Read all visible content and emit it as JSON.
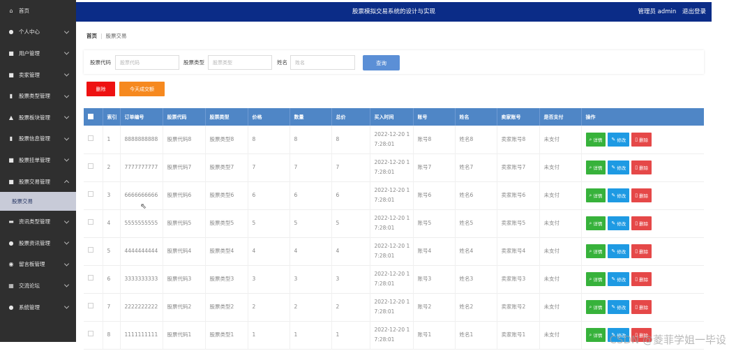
{
  "header": {
    "title": "股票模拟交易系统的设计与实现",
    "user_label": "管理员 admin",
    "logout_label": "退出登录"
  },
  "sidebar": {
    "items": [
      {
        "label": "首页",
        "icon": "home-icon",
        "expandable": false
      },
      {
        "label": "个人中心",
        "icon": "user-icon",
        "expandable": true
      },
      {
        "label": "用户管理",
        "icon": "grid-icon",
        "expandable": true
      },
      {
        "label": "卖家管理",
        "icon": "grid-icon",
        "expandable": true
      },
      {
        "label": "股票类型管理",
        "icon": "clipboard-icon",
        "expandable": true
      },
      {
        "label": "股票板块管理",
        "icon": "bank-icon",
        "expandable": true
      },
      {
        "label": "股票信息管理",
        "icon": "clipboard-icon",
        "expandable": true
      },
      {
        "label": "股票挂单管理",
        "icon": "grid-icon",
        "expandable": true
      },
      {
        "label": "股票交易管理",
        "icon": "grid-icon",
        "expandable": true,
        "expanded": true,
        "sub": [
          "股票交易"
        ]
      },
      {
        "label": "资讯类型管理",
        "icon": "monitor-icon",
        "expandable": true
      },
      {
        "label": "股票资讯管理",
        "icon": "user-icon",
        "expandable": true
      },
      {
        "label": "留言板管理",
        "icon": "location-icon",
        "expandable": true
      },
      {
        "label": "交流论坛",
        "icon": "table-icon",
        "expandable": true
      },
      {
        "label": "系统管理",
        "icon": "user-icon",
        "expandable": true
      }
    ]
  },
  "breadcrumb": {
    "home": "首页",
    "current": "股票交易"
  },
  "search": {
    "fields": [
      {
        "label": "股票代码",
        "placeholder": "股票代码"
      },
      {
        "label": "股票类型",
        "placeholder": "股票类型"
      },
      {
        "label": "姓名",
        "placeholder": "姓名"
      }
    ],
    "query_label": "查询"
  },
  "actions": {
    "delete_label": "删除",
    "deal_label": "今天成交额"
  },
  "table": {
    "headers": [
      "",
      "索引",
      "订单编号",
      "股票代码",
      "股票类型",
      "价格",
      "数量",
      "总价",
      "买入时间",
      "账号",
      "姓名",
      "卖家账号",
      "是否支付",
      "操作"
    ],
    "op_labels": {
      "detail": "详情",
      "edit": "修改",
      "delete": "删除"
    },
    "rows": [
      {
        "index": "1",
        "order_no": "8888888888",
        "code": "股票代码8",
        "type": "股票类型8",
        "price": "8",
        "qty": "8",
        "total": "8",
        "time_line1": "2022-12-20 1",
        "time_line2": "7:28:01",
        "account": "账号8",
        "name": "姓名8",
        "seller": "卖家账号8",
        "paid": "未支付"
      },
      {
        "index": "2",
        "order_no": "7777777777",
        "code": "股票代码7",
        "type": "股票类型7",
        "price": "7",
        "qty": "7",
        "total": "7",
        "time_line1": "2022-12-20 1",
        "time_line2": "7:28:01",
        "account": "账号7",
        "name": "姓名7",
        "seller": "卖家账号7",
        "paid": "未支付"
      },
      {
        "index": "3",
        "order_no": "6666666666",
        "code": "股票代码6",
        "type": "股票类型6",
        "price": "6",
        "qty": "6",
        "total": "6",
        "time_line1": "2022-12-20 1",
        "time_line2": "7:28:01",
        "account": "账号6",
        "name": "姓名6",
        "seller": "卖家账号6",
        "paid": "未支付"
      },
      {
        "index": "4",
        "order_no": "5555555555",
        "code": "股票代码5",
        "type": "股票类型5",
        "price": "5",
        "qty": "5",
        "total": "5",
        "time_line1": "2022-12-20 1",
        "time_line2": "7:28:01",
        "account": "账号5",
        "name": "姓名5",
        "seller": "卖家账号5",
        "paid": "未支付"
      },
      {
        "index": "5",
        "order_no": "4444444444",
        "code": "股票代码4",
        "type": "股票类型4",
        "price": "4",
        "qty": "4",
        "total": "4",
        "time_line1": "2022-12-20 1",
        "time_line2": "7:28:01",
        "account": "账号4",
        "name": "姓名4",
        "seller": "卖家账号4",
        "paid": "未支付"
      },
      {
        "index": "6",
        "order_no": "3333333333",
        "code": "股票代码3",
        "type": "股票类型3",
        "price": "3",
        "qty": "3",
        "total": "3",
        "time_line1": "2022-12-20 1",
        "time_line2": "7:28:01",
        "account": "账号3",
        "name": "姓名3",
        "seller": "卖家账号3",
        "paid": "未支付"
      },
      {
        "index": "7",
        "order_no": "2222222222",
        "code": "股票代码2",
        "type": "股票类型2",
        "price": "2",
        "qty": "2",
        "total": "2",
        "time_line1": "2022-12-20 1",
        "time_line2": "7:28:01",
        "account": "账号2",
        "name": "姓名2",
        "seller": "卖家账号2",
        "paid": "未支付"
      },
      {
        "index": "8",
        "order_no": "1111111111",
        "code": "股票代码1",
        "type": "股票类型1",
        "price": "1",
        "qty": "1",
        "total": "1",
        "time_line1": "2022-12-20 1",
        "time_line2": "7:28:01",
        "account": "账号1",
        "name": "姓名1",
        "seller": "卖家账号1",
        "paid": "未支付"
      }
    ]
  },
  "watermark": "CSDN @菱菲学姐一毕设",
  "colors": {
    "sidebar": "#2f2f2f",
    "topbar": "#0b2c87",
    "table_header": "#4f86c6",
    "delete": "#ee1111",
    "deal": "#f6891f",
    "detail": "#37b23b",
    "edit": "#1e9ae3",
    "row_delete": "#e54848"
  }
}
